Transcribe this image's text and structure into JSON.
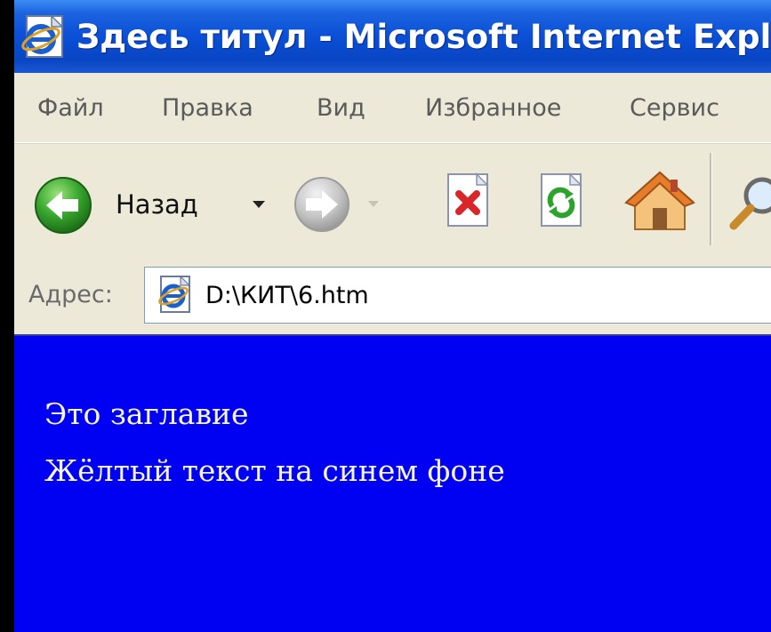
{
  "window": {
    "title": "Здесь титул - Microsoft Internet Explorer"
  },
  "menu": {
    "items": [
      "Файл",
      "Правка",
      "Вид",
      "Избранное",
      "Сервис"
    ]
  },
  "toolbar": {
    "back_label": "Назад",
    "icons": {
      "back": "back-arrow-icon",
      "forward": "forward-arrow-icon",
      "stop": "stop-icon",
      "refresh": "refresh-icon",
      "home": "home-icon",
      "search": "search-icon"
    }
  },
  "address": {
    "label": "Адрес:",
    "value": "D:\\КИТ\\6.htm"
  },
  "page": {
    "background": "#0000f2",
    "text_color": "#f4f4d8",
    "heading": "Это заглавие",
    "body": "Жёлтый текст на синем фоне"
  },
  "colors": {
    "title_bar": "#0a4fd6",
    "chrome": "#ece9d8",
    "back_button": "#2e9e2a"
  }
}
